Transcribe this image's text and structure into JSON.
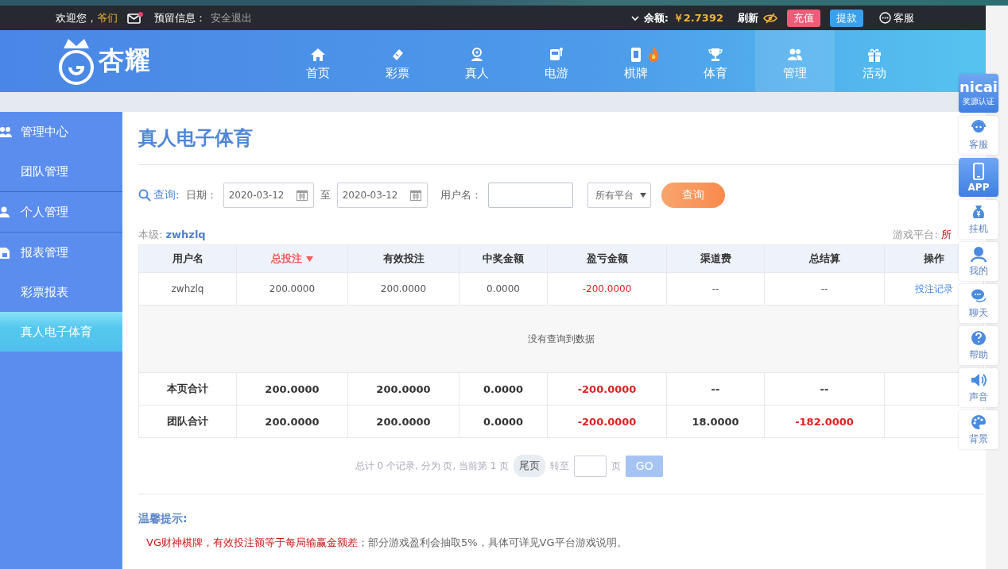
{
  "top_bar": {
    "greeting": "欢迎您，",
    "username": "爷们",
    "notice_label": "预留信息：",
    "logout": "安全退出",
    "balance_label": "余额:",
    "balance": "￥2.7392",
    "refresh": "刷新",
    "service": "客服",
    "buttons": [
      {
        "label": "充值",
        "kind": "deposit"
      },
      {
        "label": "提款",
        "kind": "withdraw"
      }
    ]
  },
  "logo": {
    "text": "杏耀"
  },
  "nav": [
    {
      "label": "首页",
      "selected": false,
      "hot": false
    },
    {
      "label": "彩票",
      "selected": false,
      "hot": false
    },
    {
      "label": "真人",
      "selected": false,
      "hot": false
    },
    {
      "label": "电游",
      "selected": false,
      "hot": false
    },
    {
      "label": "棋牌",
      "selected": false,
      "hot": true
    },
    {
      "label": "体育",
      "selected": false,
      "hot": false
    },
    {
      "label": "管理",
      "selected": true,
      "hot": false
    },
    {
      "label": "活动",
      "selected": false,
      "hot": false
    }
  ],
  "sidebar": [
    {
      "title": "管理中心",
      "children": [
        {
          "label": "团队管理",
          "selected": false
        }
      ]
    },
    {
      "title": "个人管理"
    },
    {
      "title": "报表管理",
      "children": [
        {
          "label": "彩票报表",
          "selected": false
        },
        {
          "label": "真人电子体育",
          "selected": true
        }
      ]
    }
  ],
  "page_title": "真人电子体育",
  "filters": {
    "query_label": "查询:",
    "date_label": "日期：",
    "date_from": "2020-03-12",
    "to": "至",
    "date_to": "2020-03-12",
    "username_label": "用户名：",
    "platform": "所有平台",
    "search_button": "查询"
  },
  "level": {
    "label": "本级:",
    "user": "zwhzlq",
    "platform_label": "游戏平台:",
    "platform_value": "所"
  },
  "table": {
    "columns": [
      {
        "label": "用户名",
        "sorted": false
      },
      {
        "label": "总投注",
        "sorted": true
      },
      {
        "label": "有效投注",
        "sorted": false
      },
      {
        "label": "中奖金额",
        "sorted": false
      },
      {
        "label": "盈亏金额",
        "sorted": false
      },
      {
        "label": "渠道费",
        "sorted": false
      },
      {
        "label": "总结算",
        "sorted": false
      },
      {
        "label": "操作",
        "sorted": false
      }
    ],
    "rows": [
      {
        "kind": "data",
        "cells": [
          {
            "text": "zwhzlq",
            "negative": false
          },
          {
            "text": "200.0000",
            "negative": false
          },
          {
            "text": "200.0000",
            "negative": false
          },
          {
            "text": "0.0000",
            "negative": false
          },
          {
            "text": "-200.0000",
            "negative": true
          },
          {
            "text": "--",
            "negative": false
          },
          {
            "text": "--",
            "negative": false
          },
          {
            "text": "投注记录",
            "kind": "link"
          }
        ]
      },
      {
        "kind": "empty",
        "text": "没有查询到数据"
      },
      {
        "kind": "total",
        "cells": [
          {
            "text": "本页合计",
            "negative": false
          },
          {
            "text": "200.0000",
            "negative": false
          },
          {
            "text": "200.0000",
            "negative": false
          },
          {
            "text": "0.0000",
            "negative": false
          },
          {
            "text": "-200.0000",
            "negative": true
          },
          {
            "text": "--",
            "negative": false
          },
          {
            "text": "--",
            "negative": false
          }
        ]
      },
      {
        "kind": "total",
        "cells": [
          {
            "text": "团队合计",
            "negative": false
          },
          {
            "text": "200.0000",
            "negative": false
          },
          {
            "text": "200.0000",
            "negative": false
          },
          {
            "text": "0.0000",
            "negative": false
          },
          {
            "text": "-200.0000",
            "negative": true
          },
          {
            "text": "18.0000",
            "negative": false
          },
          {
            "text": "-182.0000",
            "negative": true
          }
        ]
      }
    ]
  },
  "pagination": {
    "summary": "总计 0 个记录, 分为 页, 当前第 1 页",
    "last": "尾页",
    "goto": "转至",
    "page": "页",
    "go": "GO"
  },
  "tips": {
    "title": "温馨提示:",
    "warning": "VG财神棋牌，有效投注额等于每局输赢金额差",
    "note": "；部分游戏盈利会抽取5%，具体可详见VG平台游戏说明。"
  },
  "dock": [
    {
      "kind": "logo",
      "brand": "nicai",
      "label": "奖源认证",
      "selected": true
    },
    {
      "kind": "tool",
      "label": "客服",
      "selected": false
    },
    {
      "kind": "tool",
      "label": "APP",
      "selected": true
    },
    {
      "kind": "tool",
      "label": "挂机",
      "selected": false
    },
    {
      "kind": "tool",
      "label": "我的",
      "selected": false
    },
    {
      "kind": "tool",
      "label": "聊天",
      "selected": false
    },
    {
      "kind": "tool",
      "label": "帮助",
      "selected": false
    },
    {
      "kind": "tool",
      "label": "声音",
      "selected": false
    },
    {
      "kind": "tool",
      "label": "背景",
      "selected": false
    }
  ]
}
